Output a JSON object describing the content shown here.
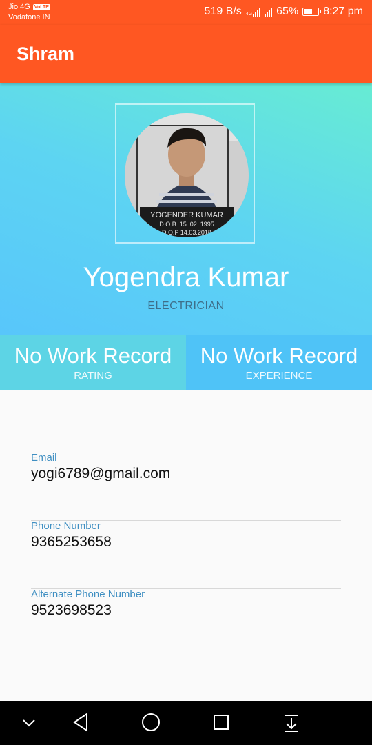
{
  "status_bar": {
    "carrier1": "Jio 4G",
    "volte": "VoLTE",
    "carrier2": "Vodafone IN",
    "speed": "519 B/s",
    "network": "4G",
    "battery": "65%",
    "battery_level": 0.65,
    "time": "8:27 pm"
  },
  "app_bar": {
    "title": "Shram"
  },
  "profile": {
    "photo_text": [
      "YOGENDER KUMAR",
      "D.O.B. 15. 02. 1995",
      "D.O.P 14.03.2018"
    ],
    "name": "Yogendra Kumar",
    "role": "ELECTRICIAN"
  },
  "stats": [
    {
      "value": "No Work Record",
      "label": "RATING"
    },
    {
      "value": "No Work Record",
      "label": "EXPERIENCE"
    }
  ],
  "details": [
    {
      "label": "Email",
      "value": "yogi6789@gmail.com"
    },
    {
      "label": "Phone Number",
      "value": "9365253658"
    },
    {
      "label": "Alternate Phone Number",
      "value": "9523698523"
    }
  ],
  "nav_bar": {
    "icons": [
      "chevron-down-icon",
      "back-icon",
      "home-icon",
      "recents-icon",
      "notification-pull-icon"
    ]
  },
  "colors": {
    "primary": "#ff5722",
    "hero_start": "#58c6fb",
    "hero_end": "#67ecd3",
    "rating_bg": "#5dd4e5",
    "experience_bg": "#4fc3f7",
    "field_label": "#3f8fc2"
  }
}
